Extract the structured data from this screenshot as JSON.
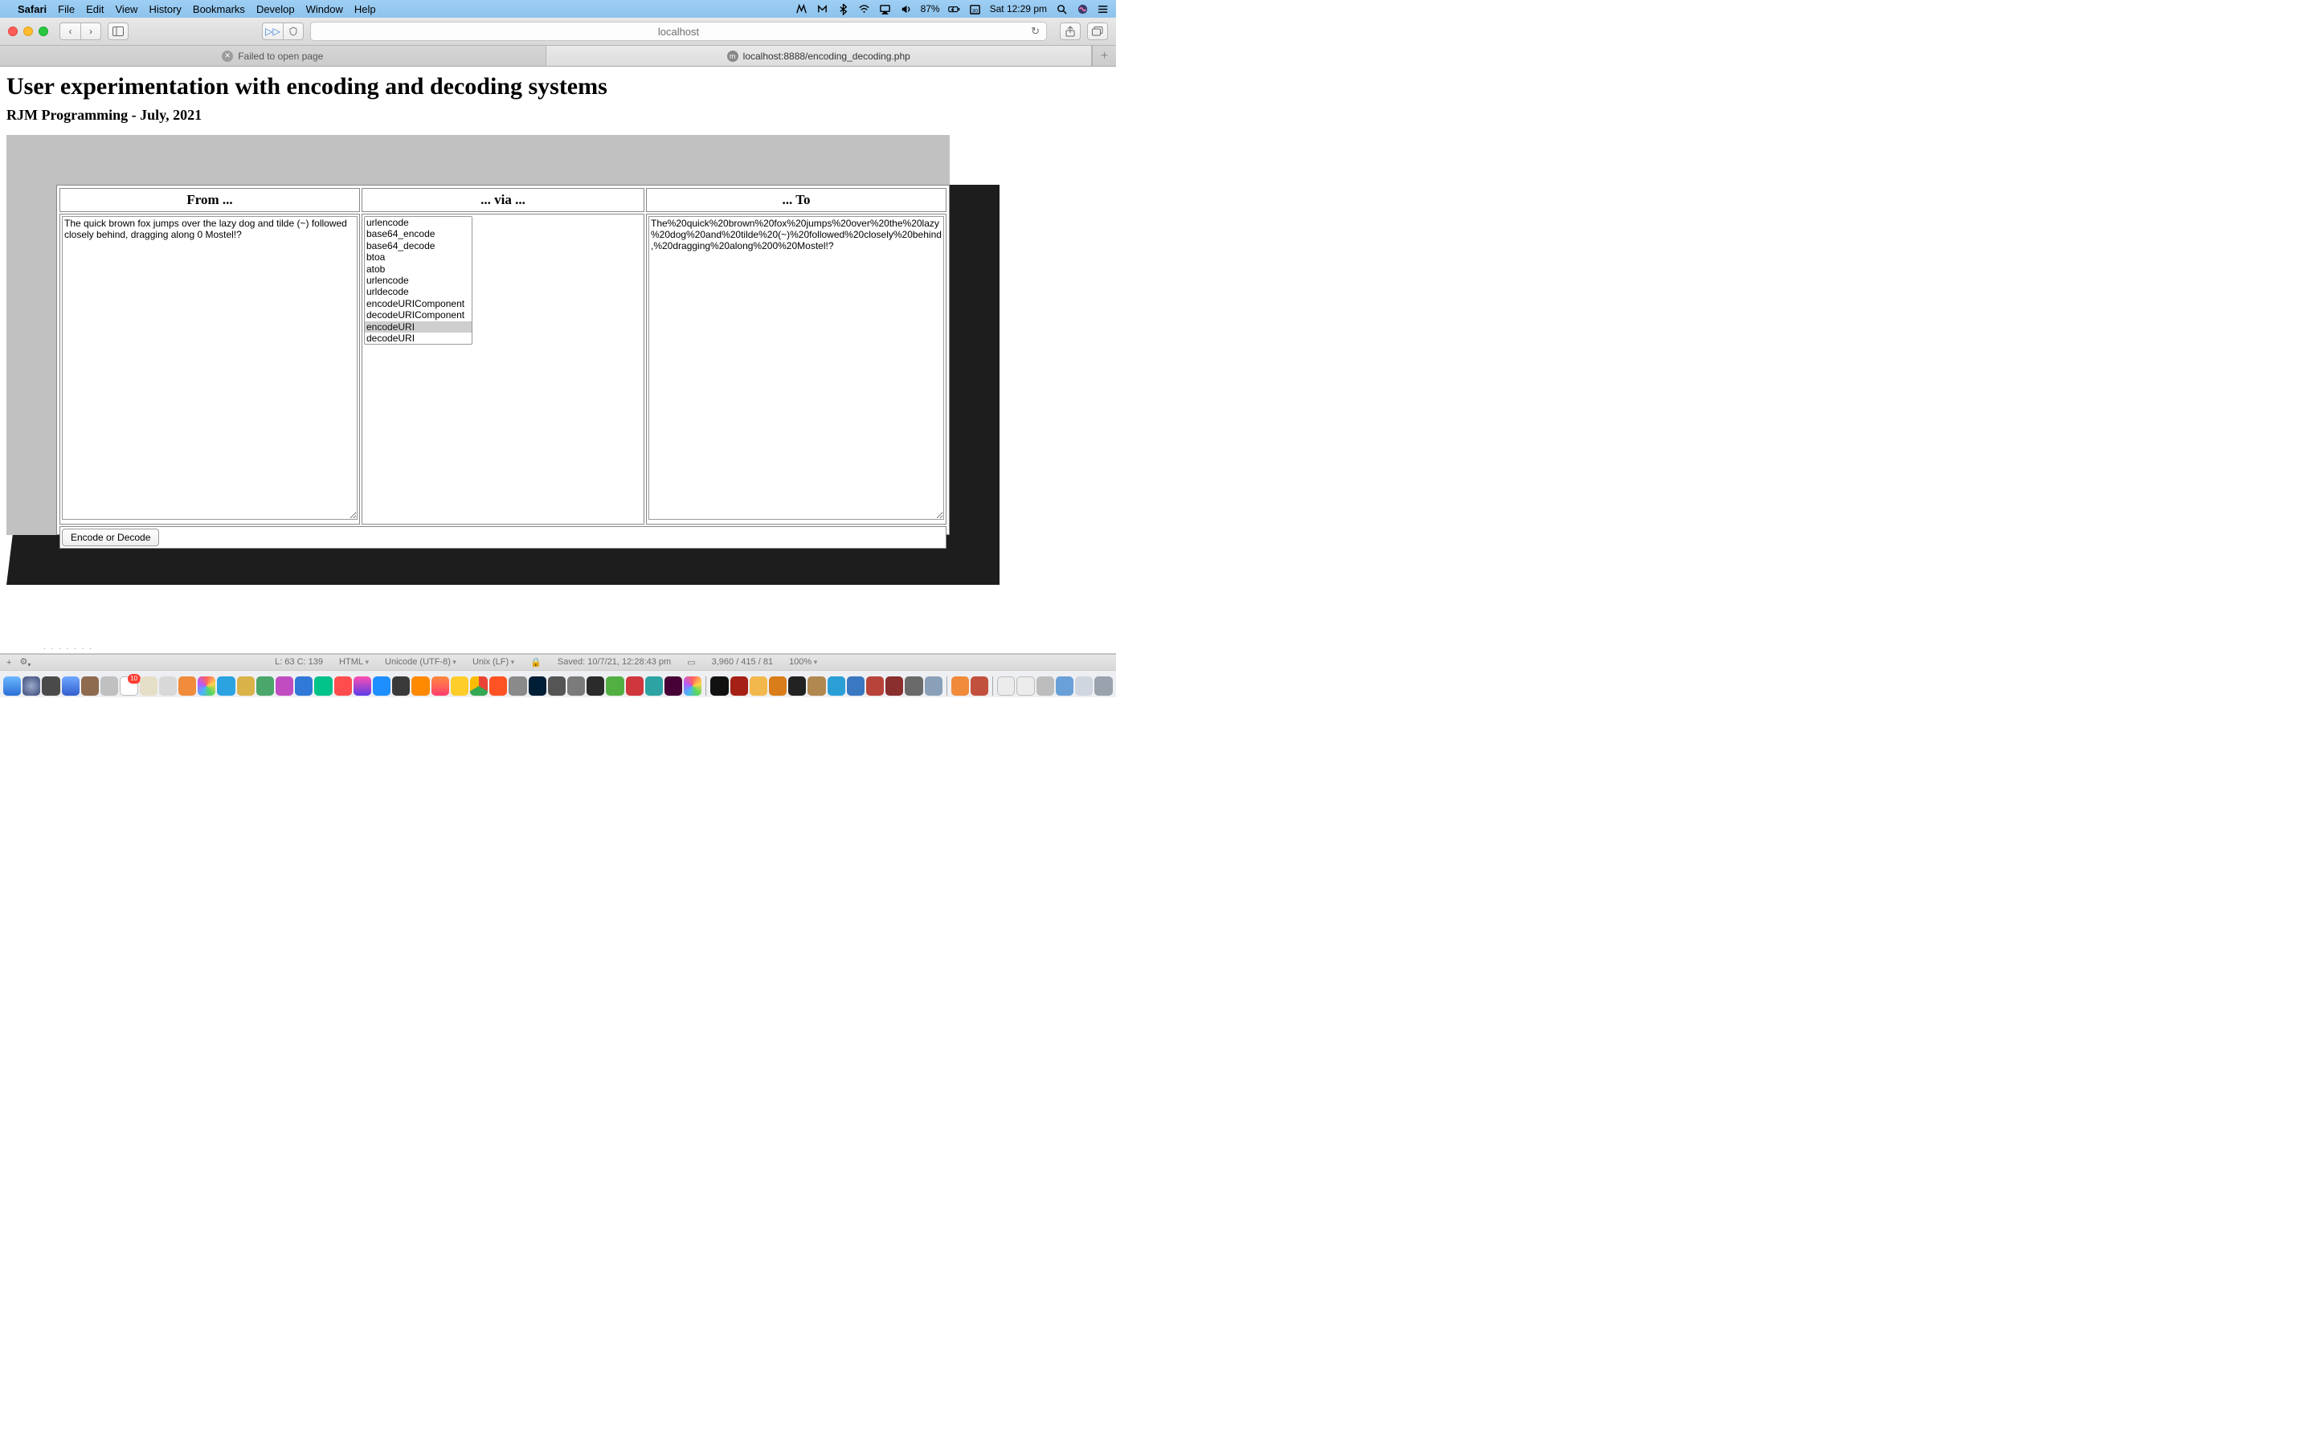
{
  "menubar": {
    "app": "Safari",
    "items": [
      "File",
      "Edit",
      "View",
      "History",
      "Bookmarks",
      "Develop",
      "Window",
      "Help"
    ],
    "battery": "87%",
    "clock": "Sat 12:29 pm"
  },
  "toolbar": {
    "address": "localhost"
  },
  "tabs": [
    {
      "label": "Failed to open page",
      "active": false
    },
    {
      "label": "localhost:8888/encoding_decoding.php",
      "active": true
    }
  ],
  "page": {
    "title": "User experimentation with encoding and decoding systems",
    "subtitle": "RJM Programming - July, 2021",
    "headers": {
      "from": "From ...",
      "via": "... via ...",
      "to": "... To"
    },
    "from_text": "The quick brown fox jumps over the lazy dog and tilde (~) followed closely behind, dragging along 0 Mostel!?",
    "to_text": "The%20quick%20brown%20fox%20jumps%20over%20the%20lazy%20dog%20and%20tilde%20(~)%20followed%20closely%20behind,%20dragging%20along%200%20Mostel!?",
    "via_options": [
      "urlencode",
      "base64_encode",
      "base64_decode",
      "btoa",
      "atob",
      "urlencode",
      "urldecode",
      "encodeURIComponent",
      "decodeURIComponent",
      "encodeURI",
      "decodeURI"
    ],
    "via_selected": "encodeURI",
    "button": "Encode or Decode"
  },
  "statusbar": {
    "pos": "L: 63 C: 139",
    "lang": "HTML",
    "enc": "Unicode (UTF-8)",
    "eol": "Unix (LF)",
    "saved": "Saved: 10/7/21, 12:28:43 pm",
    "bytes": "3,960 / 415 / 81",
    "zoom": "100%"
  },
  "dock_badge": "10"
}
